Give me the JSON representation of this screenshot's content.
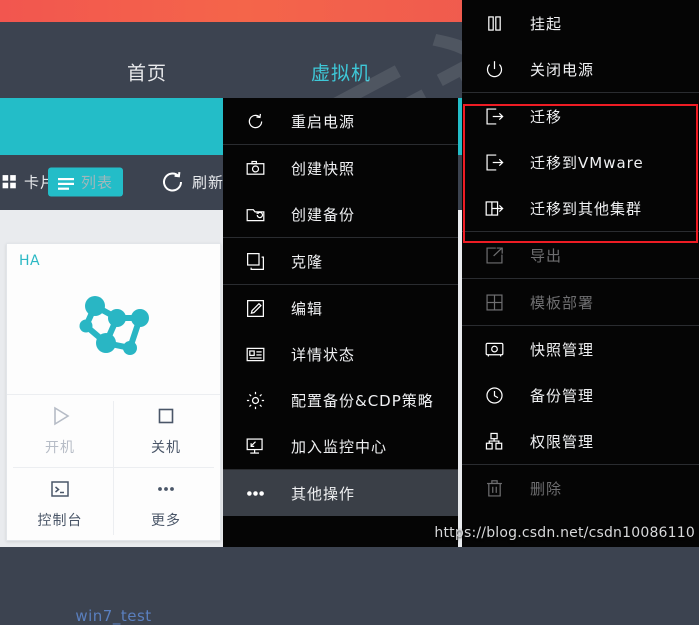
{
  "topbar": {
    "nav_home": "首页",
    "nav_vm": "虚拟机"
  },
  "toolbar": {
    "card_label": "卡片",
    "list_label": "列表",
    "refresh_label": "刷新"
  },
  "vm_card": {
    "ha_badge": "HA",
    "name": "win7_test",
    "actions": [
      {
        "label": "开机",
        "icon": "play-icon",
        "disabled": true
      },
      {
        "label": "关机",
        "icon": "stop-square-icon",
        "disabled": false
      },
      {
        "label": "控制台",
        "icon": "console-icon",
        "disabled": false
      },
      {
        "label": "更多",
        "icon": "ellipsis-icon",
        "disabled": false
      }
    ]
  },
  "middle_menu": {
    "items": [
      {
        "label": "重启电源",
        "icon": "restart-icon",
        "disabled": false,
        "highlight": false,
        "sep_after": true
      },
      {
        "label": "创建快照",
        "icon": "camera-icon",
        "disabled": false,
        "highlight": false,
        "sep_after": false
      },
      {
        "label": "创建备份",
        "icon": "backup-icon",
        "disabled": false,
        "highlight": false,
        "sep_after": true
      },
      {
        "label": "克隆",
        "icon": "clone-icon",
        "disabled": false,
        "highlight": false,
        "sep_after": true
      },
      {
        "label": "编辑",
        "icon": "edit-icon",
        "disabled": false,
        "highlight": false,
        "sep_after": false
      },
      {
        "label": "详情状态",
        "icon": "details-icon",
        "disabled": false,
        "highlight": false,
        "sep_after": false
      },
      {
        "label": "配置备份&CDP策略",
        "icon": "gear-icon",
        "disabled": false,
        "highlight": false,
        "sep_after": false
      },
      {
        "label": "加入监控中心",
        "icon": "monitor-icon",
        "disabled": false,
        "highlight": false,
        "sep_after": true
      },
      {
        "label": "其他操作",
        "icon": "ellipsis-icon",
        "disabled": false,
        "highlight": true,
        "sep_after": false
      }
    ]
  },
  "right_menu": {
    "items": [
      {
        "label": "挂起",
        "icon": "pause-icon",
        "disabled": false,
        "highlight": false,
        "sep_after": false
      },
      {
        "label": "关闭电源",
        "icon": "power-icon",
        "disabled": false,
        "highlight": false,
        "sep_after": true
      },
      {
        "label": "迁移",
        "icon": "migrate-icon",
        "disabled": false,
        "highlight": false,
        "sep_after": false
      },
      {
        "label": "迁移到VMware",
        "icon": "migrate-icon",
        "disabled": false,
        "highlight": false,
        "sep_after": false
      },
      {
        "label": "迁移到其他集群",
        "icon": "migrate-cluster-icon",
        "disabled": false,
        "highlight": false,
        "sep_after": true
      },
      {
        "label": "导出",
        "icon": "export-icon",
        "disabled": true,
        "highlight": false,
        "sep_after": true
      },
      {
        "label": "模板部署",
        "icon": "template-icon",
        "disabled": true,
        "highlight": false,
        "sep_after": true
      },
      {
        "label": "快照管理",
        "icon": "snapshot-icon",
        "disabled": false,
        "highlight": false,
        "sep_after": false
      },
      {
        "label": "备份管理",
        "icon": "history-icon",
        "disabled": false,
        "highlight": false,
        "sep_after": false
      },
      {
        "label": "权限管理",
        "icon": "permission-icon",
        "disabled": false,
        "highlight": false,
        "sep_after": true
      },
      {
        "label": "删除",
        "icon": "trash-icon",
        "disabled": true,
        "highlight": false,
        "sep_after": false
      }
    ]
  },
  "watermark": {
    "url": "https://blog.csdn.net/csdn10086110",
    "text": "云计算"
  },
  "colors": {
    "accent_teal": "#23bdc8",
    "accent_orange": "#f2564f",
    "highlight_red": "#ee1c24",
    "menu_bg": "#050505",
    "app_bg": "#3c4350"
  }
}
